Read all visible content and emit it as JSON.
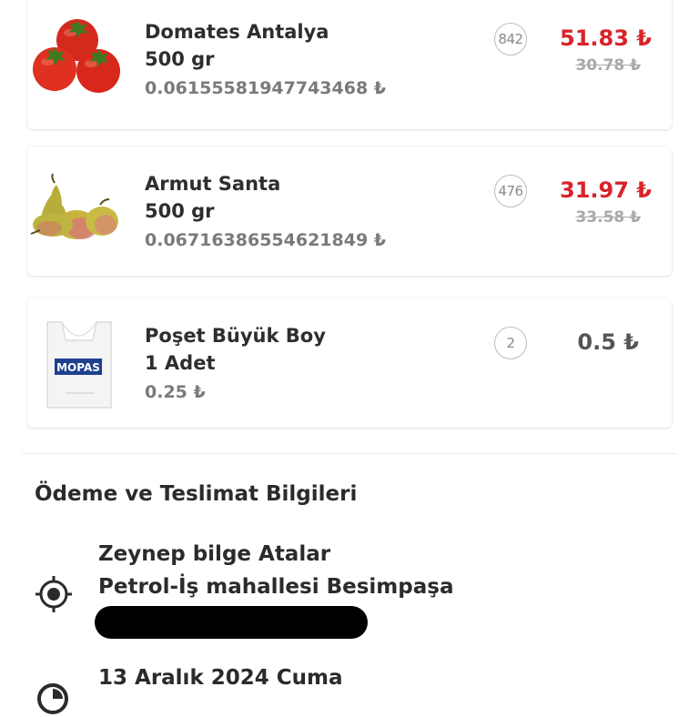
{
  "items": [
    {
      "name": "Domates Antalya",
      "quantity": "500 gr",
      "unit_price": "0.06155581947743468 ₺",
      "count": "842",
      "price": "51.83 ₺",
      "old_price": "30.78 ₺",
      "image": "tomato-image"
    },
    {
      "name": "Armut Santa",
      "quantity": "500 gr",
      "unit_price": "0.06716386554621849 ₺",
      "count": "476",
      "price": "31.97 ₺",
      "old_price": "33.58 ₺",
      "image": "pear-image"
    },
    {
      "name": "Poşet Büyük Boy",
      "quantity": "1 Adet",
      "unit_price": "0.25 ₺",
      "count": "2",
      "price": "0.5 ₺",
      "old_price": "",
      "image": "plastic-bag-image",
      "bag_brand": "MOPAS"
    }
  ],
  "payment_delivery": {
    "title": "Ödeme ve Teslimat Bilgileri",
    "recipient": "Zeynep  bilge Atalar",
    "address_line": "Petrol-İş mahallesi Besimpaşa",
    "date": "13 Aralık 2024 Cuma"
  },
  "colors": {
    "price_red": "#d8232a",
    "text_dark": "#2b2b2b",
    "text_gray": "#7a7a7a",
    "strike_gray": "#a9a9a9"
  }
}
